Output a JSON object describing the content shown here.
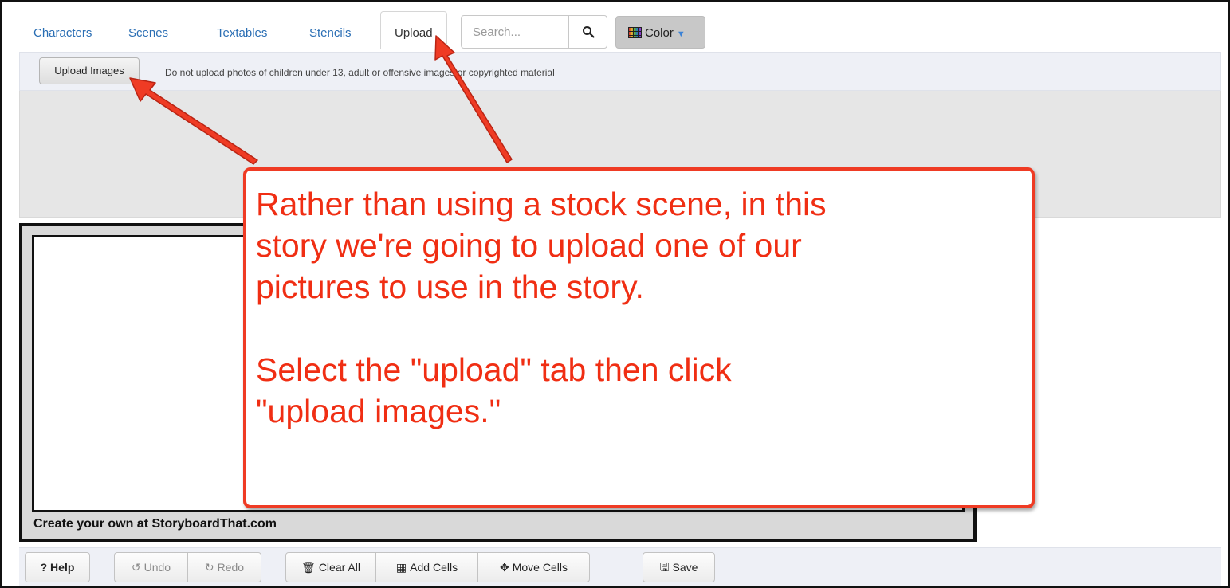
{
  "tabs": [
    {
      "label": "Characters"
    },
    {
      "label": "Scenes"
    },
    {
      "label": "Textables"
    },
    {
      "label": "Stencils"
    },
    {
      "label": "Upload",
      "active": true
    }
  ],
  "search": {
    "placeholder": "Search...",
    "icon": "magnifier-icon"
  },
  "color_button": {
    "label": "Color",
    "icon": "color-grid-icon"
  },
  "upload_panel": {
    "button_label": "Upload Images",
    "notice": "Do not upload photos of children under 13, adult or offensive images or copyrighted material"
  },
  "storyboard": {
    "footer": "Create your own at StoryboardThat.com"
  },
  "toolbar": {
    "help": "? Help",
    "undo": "Undo",
    "redo": "Redo",
    "clear_all": "Clear All",
    "add_cells": "Add Cells",
    "move_cells": "Move Cells",
    "save": "Save"
  },
  "annotation": {
    "lines": [
      "Rather than using a stock scene, in this",
      "story we're going to upload one of our",
      "pictures to use in the story.",
      "",
      "Select the \"upload\" tab then click",
      "\"upload images.\""
    ],
    "color": "#f02e13"
  },
  "colors": {
    "link": "#2a6eb4",
    "annotation": "#ef3b24",
    "panel_bg": "#eef0f6"
  }
}
